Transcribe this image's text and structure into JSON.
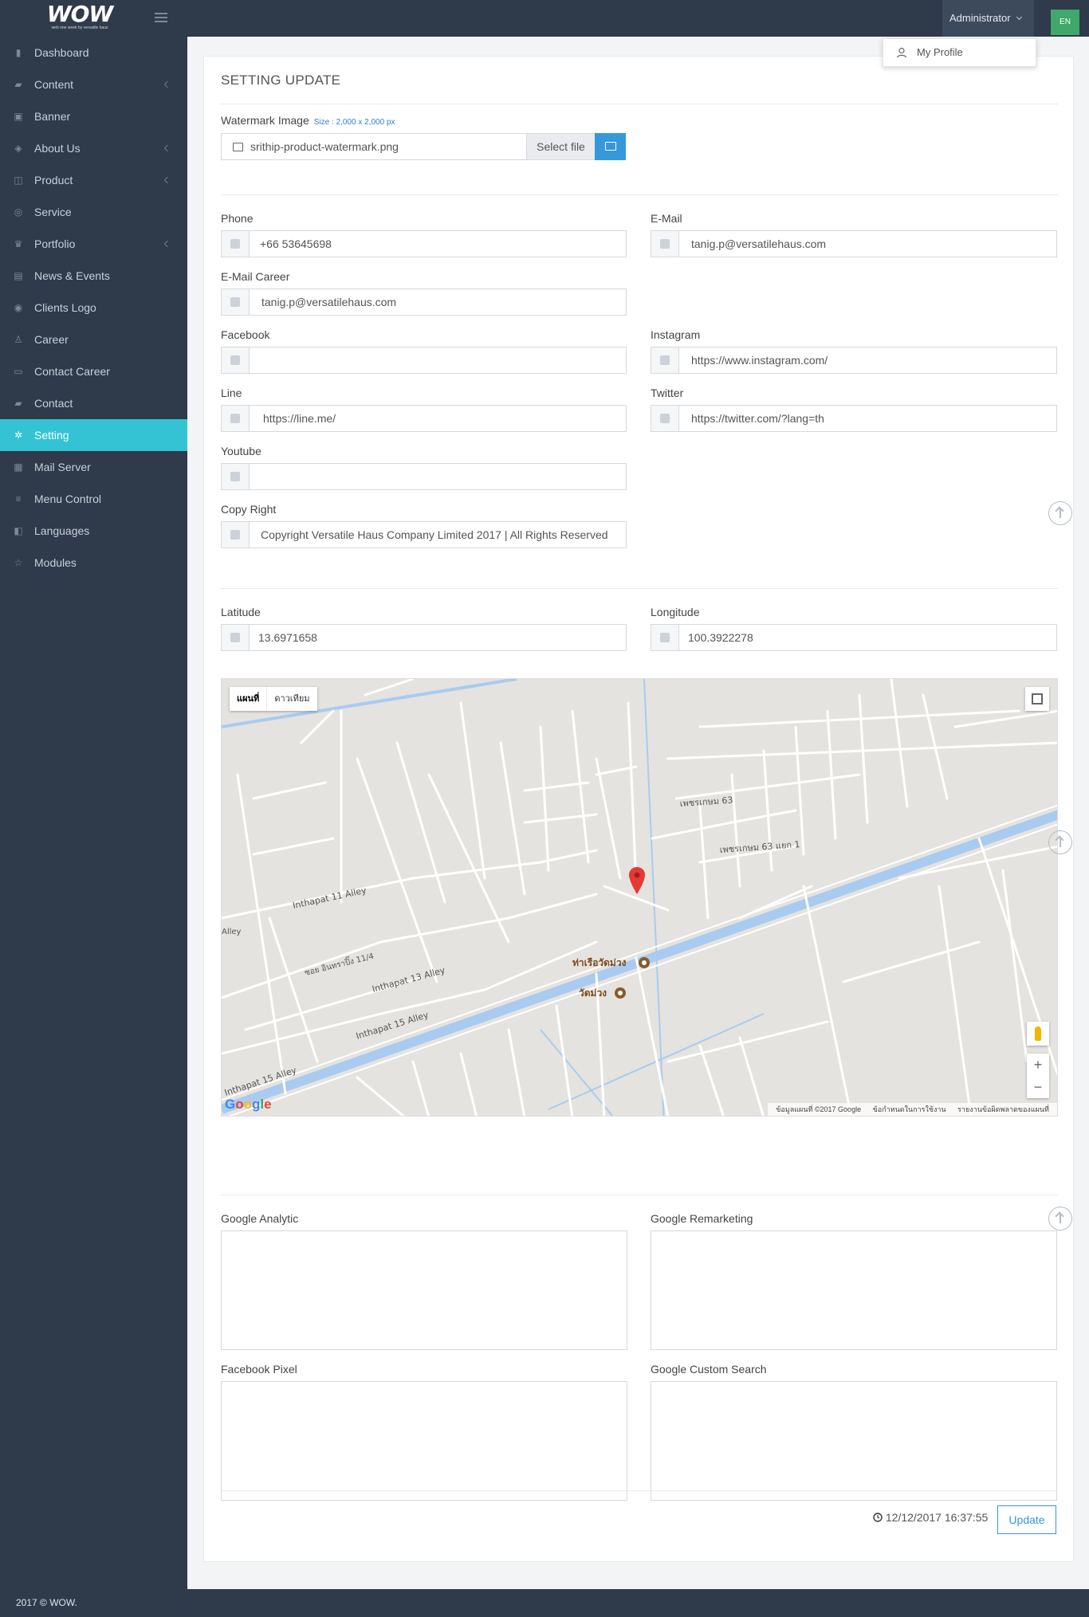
{
  "topbar": {
    "logo_text": "WOW",
    "logo_tagline": "web one week by versatile haus",
    "admin_label": "Administrator",
    "lang_badge": "EN",
    "profile_menu_item": "My Profile"
  },
  "sidebar": {
    "items": [
      {
        "label": "Dashboard",
        "icon": "bar-chart-icon",
        "has_children": false
      },
      {
        "label": "Content",
        "icon": "book-icon",
        "has_children": true
      },
      {
        "label": "Banner",
        "icon": "image-icon",
        "has_children": false
      },
      {
        "label": "About Us",
        "icon": "tags-icon",
        "has_children": true
      },
      {
        "label": "Product",
        "icon": "cart-icon",
        "has_children": true
      },
      {
        "label": "Service",
        "icon": "support-icon",
        "has_children": false
      },
      {
        "label": "Portfolio",
        "icon": "trophy-icon",
        "has_children": true
      },
      {
        "label": "News & Events",
        "icon": "newspaper-icon",
        "has_children": false
      },
      {
        "label": "Clients Logo",
        "icon": "dribbble-icon",
        "has_children": false
      },
      {
        "label": "Career",
        "icon": "person-icon",
        "has_children": false
      },
      {
        "label": "Contact Career",
        "icon": "inbox-icon",
        "has_children": false
      },
      {
        "label": "Contact",
        "icon": "book-icon",
        "has_children": false
      },
      {
        "label": "Setting",
        "icon": "gears-icon",
        "has_children": false,
        "active": true
      },
      {
        "label": "Mail Server",
        "icon": "database-icon",
        "has_children": false
      },
      {
        "label": "Menu Control",
        "icon": "list-icon",
        "has_children": false
      },
      {
        "label": "Languages",
        "icon": "language-icon",
        "has_children": false
      },
      {
        "label": "Modules",
        "icon": "star-icon",
        "has_children": false
      }
    ],
    "footer": "2017 © WOW."
  },
  "form": {
    "title": "SETTING UPDATE",
    "watermark": {
      "label": "Watermark Image",
      "size_note": "Size : 2,000 x 2,000 px",
      "filename": "srithip-product-watermark.png",
      "select_label": "Select file"
    },
    "fields": {
      "phone": {
        "label": "Phone",
        "value": "+66 53645698"
      },
      "email": {
        "label": "E-Mail",
        "value": "tanig.p@versatilehaus.com"
      },
      "email_career": {
        "label": "E-Mail Career",
        "value": "tanig.p@versatilehaus.com"
      },
      "facebook": {
        "label": "Facebook",
        "value": ""
      },
      "instagram": {
        "label": "Instagram",
        "value": "https://www.instagram.com/"
      },
      "line": {
        "label": "Line",
        "value": "https://line.me/"
      },
      "twitter": {
        "label": "Twitter",
        "value": "https://twitter.com/?lang=th"
      },
      "youtube": {
        "label": "Youtube",
        "value": ""
      },
      "copyright": {
        "label": "Copy Right",
        "value": "Copyright Versatile Haus Company Limited 2017 | All Rights Reserved"
      },
      "latitude": {
        "label": "Latitude",
        "value": "13.6971658"
      },
      "longitude": {
        "label": "Longitude",
        "value": "100.3922278"
      }
    },
    "map": {
      "type_map": "แผนที่",
      "type_satellite": "ดาวเทียม",
      "google": "Google",
      "attrib_data": "ข้อมูลแผนที่ ©2017 Google",
      "attrib_terms": "ข้อกำหนดในการใช้งาน",
      "attrib_report": "รายงานข้อผิดพลาดของแผนที่",
      "zoom_in": "+",
      "zoom_out": "−",
      "labels": {
        "pier": "ท่าเรือวัดม่วง",
        "temple": "วัดม่วง",
        "road1": "Inthapat 11 Alley",
        "road2": "Inthapat 13 Alley",
        "road3": "Inthapat 15 Alley",
        "road4": "Inthapat 15 Alley",
        "road5": "เพชรเกษม 63",
        "road6": "เพชรเกษม 63 แยก 1",
        "road7": "ซอย อินทราปิ๊ง 11/4",
        "road8": "Alley"
      }
    },
    "tracking": {
      "google_analytic": "Google Analytic",
      "google_remarketing": "Google Remarketing",
      "facebook_pixel": "Facebook Pixel",
      "google_custom_search": "Google Custom Search"
    },
    "timestamp": "12/12/2017 16:37:55",
    "update_label": "Update"
  }
}
